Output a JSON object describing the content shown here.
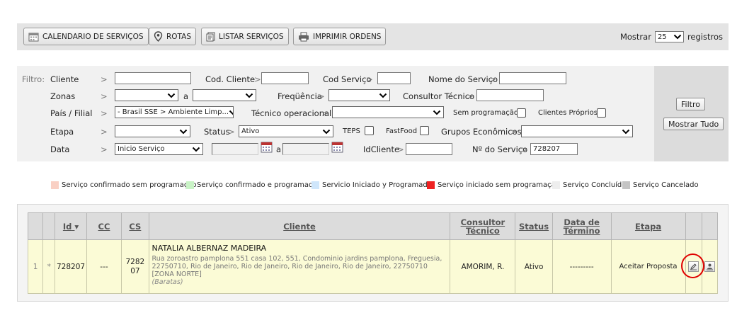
{
  "toolbar": {
    "calendar_label": "CALENDARIO DE SERVIÇOS",
    "rotas_label": "ROTAS",
    "listar_label": "LISTAR SERVIÇOS",
    "imprimir_label": "IMPRIMIR ORDENS",
    "show_label": "Mostrar",
    "show_value": "25",
    "records_label": "registros"
  },
  "filter": {
    "title": "Filtro:",
    "cliente_label": "Cliente",
    "cod_cliente_label": "Cod. Cliente",
    "cod_servico_label": "Cod Serviço",
    "nome_servico_label": "Nome do Serviço",
    "zonas_label": "Zonas",
    "a_label": "a",
    "frequencia_label": "Freqüência",
    "consultor_label": "Consultor Técnico",
    "pais_label": "País / Filial",
    "pais_value": "- Brasil SSE > Ambiente Limp...",
    "tecnico_label": "Técnico operacional",
    "sem_prog_label": "Sem programação",
    "clientes_proprios_label": "Clientes Próprios",
    "etapa_label": "Etapa",
    "status_label": "Status",
    "status_value": "Ativo",
    "teps_label": "TEPS",
    "fastfood_label": "FastFood",
    "grupos_label": "Grupos Econômicos",
    "data_label": "Data",
    "data_value": "Inicio Serviço",
    "idcliente_label": "IdCliente",
    "no_servico_label": "Nº do Serviço",
    "no_servico_value": "728207",
    "arrow": ">",
    "filtro_button": "Filtro",
    "mostrar_tudo_button": "Mostrar Tudo"
  },
  "legend": [
    {
      "label": "Serviço confirmado sem programação",
      "color": "#f9d0c4"
    },
    {
      "label": "Serviço confirmado e programado",
      "color": "#c9f3c6"
    },
    {
      "label": "Servicio Iniciado y Programado",
      "color": "#cfe6fb"
    },
    {
      "label": "Serviço iniciado sem programação",
      "color": "#ee2222"
    },
    {
      "label": "Serviço Concluído",
      "color": "#eeeeee"
    },
    {
      "label": "Serviço Cancelado",
      "color": "#c4c4c4"
    }
  ],
  "table": {
    "headers": {
      "id": "Id",
      "sort_icon": "▾",
      "cc": "CC",
      "cs": "CS",
      "cliente": "Cliente",
      "consultor": "Consultor Técnico",
      "status": "Status",
      "data_termino": "Data de Término",
      "etapa": "Etapa"
    },
    "row": {
      "num": "1",
      "mark": "*",
      "id": "728207",
      "cc": "---",
      "cs": "728207",
      "client_name": "NATALIA ALBERNAZ MADEIRA",
      "address": "Rua zoroastro pamplona 551 casa 102, 551, Condominio jardins pamplona, Freguesia, 22750710, Rio de Janeiro, Rio de Janeiro, Rio de Janeiro, Rio de Janeiro, 22750710",
      "zone": "[ZONA NORTE]",
      "ref": "(Baratas)",
      "consultor": "AMORIM, R.",
      "status": "Ativo",
      "data_termino": "---------",
      "etapa": "Aceitar Proposta"
    }
  }
}
